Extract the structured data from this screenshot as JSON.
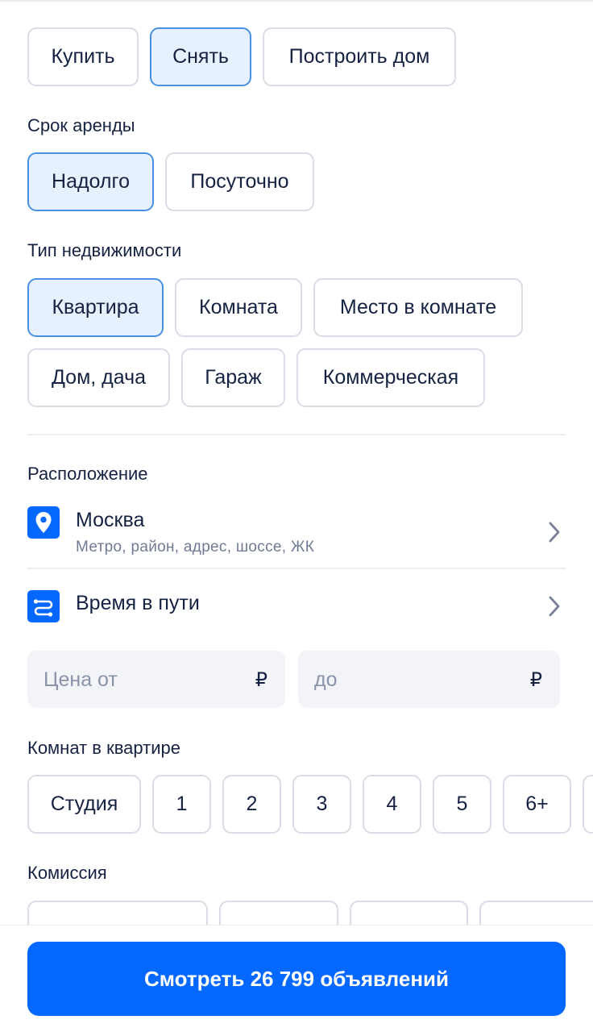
{
  "deal_type": {
    "options": [
      "Купить",
      "Снять",
      "Построить дом"
    ],
    "selected": "Снять"
  },
  "rent_term": {
    "label": "Срок аренды",
    "options": [
      "Надолго",
      "Посуточно"
    ],
    "selected": "Надолго"
  },
  "property_type": {
    "label": "Тип недвижимости",
    "row1": [
      "Квартира",
      "Комната",
      "Место в комнате"
    ],
    "row2": [
      "Дом, дача",
      "Гараж",
      "Коммерческая"
    ],
    "selected": "Квартира"
  },
  "location": {
    "label": "Расположение",
    "city": "Москва",
    "hint": "Метро, район, адрес, шоссе, ЖК",
    "travel_time": "Время в пути",
    "icon": "map-pin-icon",
    "travel_icon": "route-icon"
  },
  "price": {
    "from_placeholder": "Цена от",
    "to_placeholder": "до",
    "currency": "₽"
  },
  "rooms": {
    "label": "Комнат в квартире",
    "options": [
      "Студия",
      "1",
      "2",
      "3",
      "4",
      "5",
      "6+"
    ]
  },
  "commission": {
    "label": "Комиссия"
  },
  "cta": {
    "label": "Смотреть 26 799 объявлений"
  },
  "colors": {
    "accent": "#0468ff",
    "chip_selected_bg": "#e7f0fd",
    "chip_selected_border": "#4a90e2",
    "text": "#152242",
    "muted": "#707a95"
  }
}
